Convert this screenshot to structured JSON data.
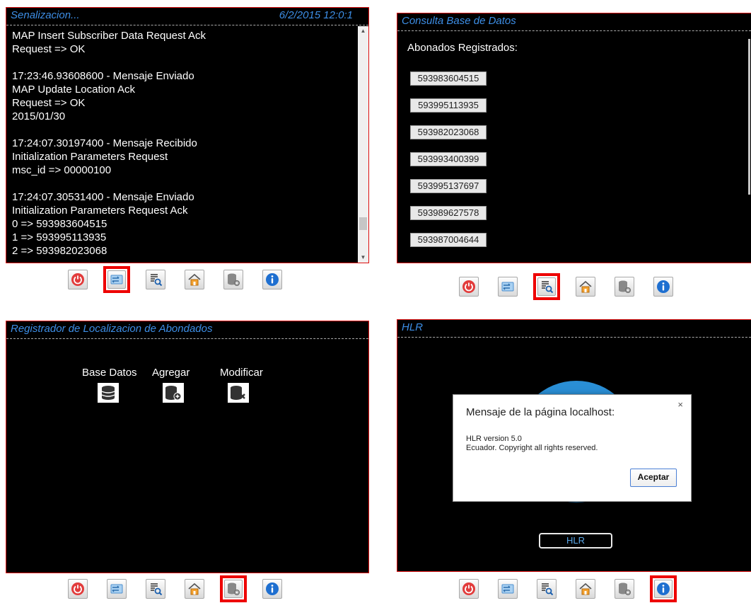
{
  "panel_tl": {
    "title": "Senalizacion...",
    "datetime": "6/2/2015  12:0:1",
    "log_lines": [
      "MAP Insert Subscriber Data Request Ack",
      "Request => OK",
      "",
      "17:23:46.93608600 - Mensaje Enviado",
      "MAP Update Location Ack",
      "Request => OK",
      "2015/01/30",
      "",
      "17:24:07.30197400 - Mensaje Recibido",
      "Initialization Parameters Request",
      "msc_id => 00000100",
      "",
      "17:24:07.30531400 - Mensaje Enviado",
      "Initialization Parameters Request Ack",
      "0 => 593983604515",
      "1 => 593995113935",
      "2 => 593982023068"
    ],
    "scrollbar": {
      "thumb_position": 0.87
    }
  },
  "panel_tr": {
    "title": "Consulta Base de Datos",
    "subscribers_label": "Abonados Registrados:",
    "subscribers": [
      "593983604515",
      "593995113935",
      "593982023068",
      "593993400399",
      "593995137697",
      "593989627578",
      "593987004644"
    ]
  },
  "panel_bl": {
    "title": "Registrador de Localizacion de Abondados",
    "menu": [
      {
        "label": "Base Datos",
        "icon": "database-icon"
      },
      {
        "label": "Agregar",
        "icon": "database-add-icon"
      },
      {
        "label": "Modificar",
        "icon": "database-delete-icon"
      }
    ]
  },
  "panel_br": {
    "title": "HLR",
    "hlr_button": "HLR",
    "dialog": {
      "title": "Mensaje de la página localhost:",
      "close": "×",
      "line1": "HLR version 5.0",
      "line2": "Ecuador. Copyright all rights reserved.",
      "ok": "Aceptar"
    }
  },
  "toolbar_buttons": [
    "power-icon",
    "signaling-icon",
    "query-icon",
    "home-icon",
    "db-settings-icon",
    "info-icon"
  ],
  "active_tabs": {
    "tl": "signaling-icon",
    "tr": "query-icon",
    "bl": "db-settings-icon",
    "br": "info-icon"
  },
  "colors": {
    "accent_blue": "#3d8ee6",
    "panel_border": "#d11111",
    "active_border": "#ee0000",
    "circle": "#2a8fd6"
  }
}
